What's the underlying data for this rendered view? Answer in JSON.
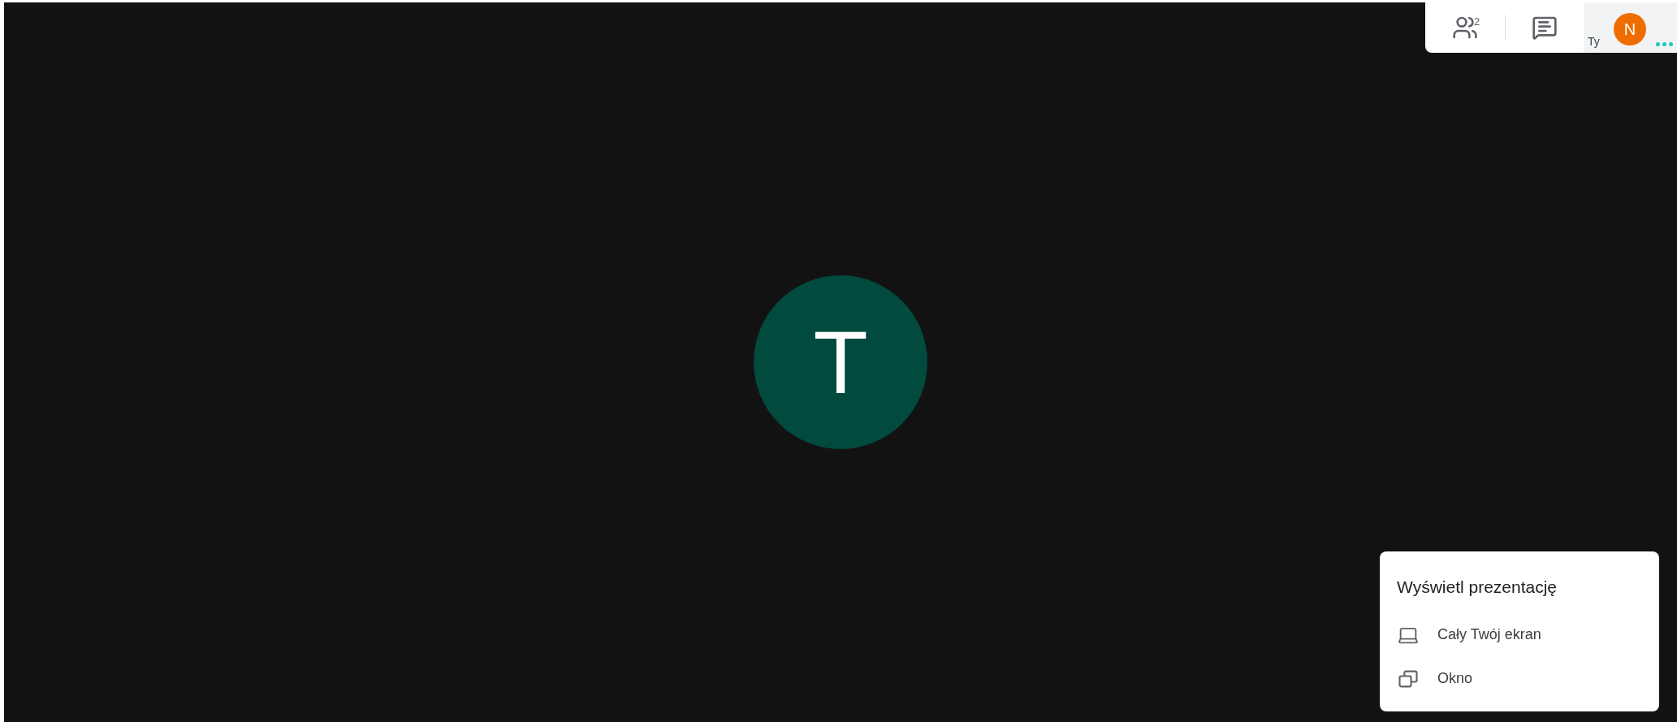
{
  "top_bar": {
    "participants_count": "2",
    "self": {
      "label": "Ty",
      "initial": "N"
    }
  },
  "main_tile": {
    "initial": "T"
  },
  "present_menu": {
    "title": "Wyświetl prezentację",
    "items": [
      {
        "kind": "screen",
        "label": "Cały Twój ekran"
      },
      {
        "kind": "window",
        "label": "Okno"
      }
    ]
  }
}
